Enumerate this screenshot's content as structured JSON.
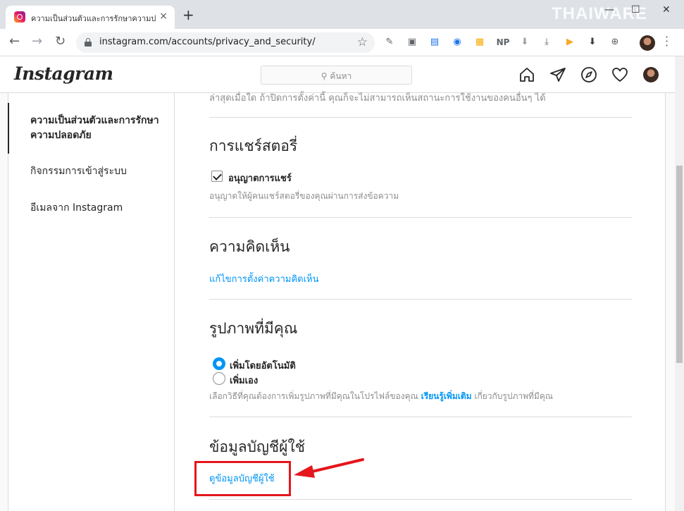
{
  "browser": {
    "tab_title": "ความเป็นส่วนตัวและการรักษาความปลอดภัย",
    "tab_close": "×",
    "new_tab": "+",
    "watermark": "THAIWARE",
    "url": "instagram.com/accounts/privacy_and_security/",
    "icons": [
      "back-icon",
      "forward-icon",
      "reload-icon",
      "lock-icon",
      "star-icon",
      "extension-icons",
      "profile-avatar",
      "menu-icon"
    ],
    "extension_np": "NP"
  },
  "ig_header": {
    "logo": "Instagram",
    "search_placeholder": "ค้นหา",
    "search_glyph": "⚲"
  },
  "sidebar": {
    "items": [
      {
        "label": "ความเป็นส่วนตัวและการรักษาความปลอดภัย",
        "active": true
      },
      {
        "label": "กิจกรรมการเข้าสู่ระบบ",
        "active": false
      },
      {
        "label": "อีเมลจาก Instagram",
        "active": false
      }
    ]
  },
  "content": {
    "truncated_top_text": "ล่าสุดเมื่อใด ถ้าปิดการตั้งค่านี้ คุณก็จะไม่สามารถเห็นสถานะการใช้งานของคนอื่นๆ ได้",
    "story_sharing": {
      "title": "การแชร์สตอรี่",
      "checkbox_label": "อนุญาตการแชร์",
      "checked": true,
      "help": "อนุญาตให้ผู้คนแชร์สตอรี่ของคุณผ่านการส่งข้อความ"
    },
    "comments": {
      "title": "ความคิดเห็น",
      "link": "แก้ไขการตั้งค่าความคิดเห็น"
    },
    "photos_of_you": {
      "title": "รูปภาพที่มีคุณ",
      "options": [
        {
          "label": "เพิ่มโดยอัตโนมัติ",
          "selected": true
        },
        {
          "label": "เพิ่มเอง",
          "selected": false
        }
      ],
      "help_before": "เลือกวิธีที่คุณต้องการเพิ่มรูปภาพที่มีคุณในโปรไฟล์ของคุณ ",
      "help_link": "เรียนรู้เพิ่มเติม",
      "help_after": " เกี่ยวกับรูปภาพที่มีคุณ"
    },
    "account_data": {
      "title": "ข้อมูลบัญชีผู้ใช้",
      "link": "ดูข้อมูลบัญชีผู้ใช้"
    }
  },
  "colors": {
    "link_blue": "#0095f6",
    "annotation_red": "#e5161c",
    "border": "#dbdbdb"
  }
}
